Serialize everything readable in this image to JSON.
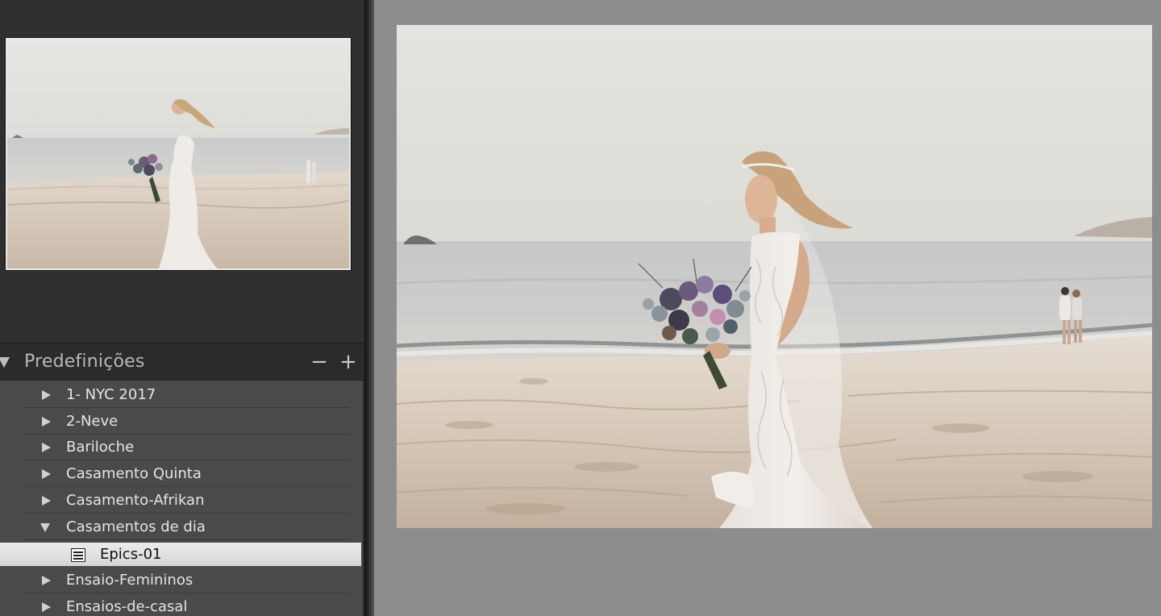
{
  "presets": {
    "title": "Predefinições",
    "minus_label": "−",
    "plus_label": "+",
    "items": [
      {
        "label": "1- NYC 2017",
        "state": "collapsed"
      },
      {
        "label": "2-Neve",
        "state": "collapsed"
      },
      {
        "label": "Bariloche",
        "state": "collapsed"
      },
      {
        "label": "Casamento Quinta",
        "state": "collapsed"
      },
      {
        "label": "Casamento-Afrikan",
        "state": "collapsed"
      },
      {
        "label": "Casamentos de dia",
        "state": "expanded"
      },
      {
        "label": "Epics-01",
        "state": "selected-preset"
      },
      {
        "label": "Ensaio-Femininos",
        "state": "collapsed"
      },
      {
        "label": "Ensaios-de-casal",
        "state": "collapsed"
      }
    ]
  },
  "colors": {
    "panel_bg": "#4a4a4a",
    "selection_bg": "#e0e0e0",
    "canvas_bg": "#8d8d8d"
  },
  "icons": {
    "expand": "triangle-right-icon",
    "collapse": "triangle-down-icon",
    "preset": "preset-list-icon"
  }
}
